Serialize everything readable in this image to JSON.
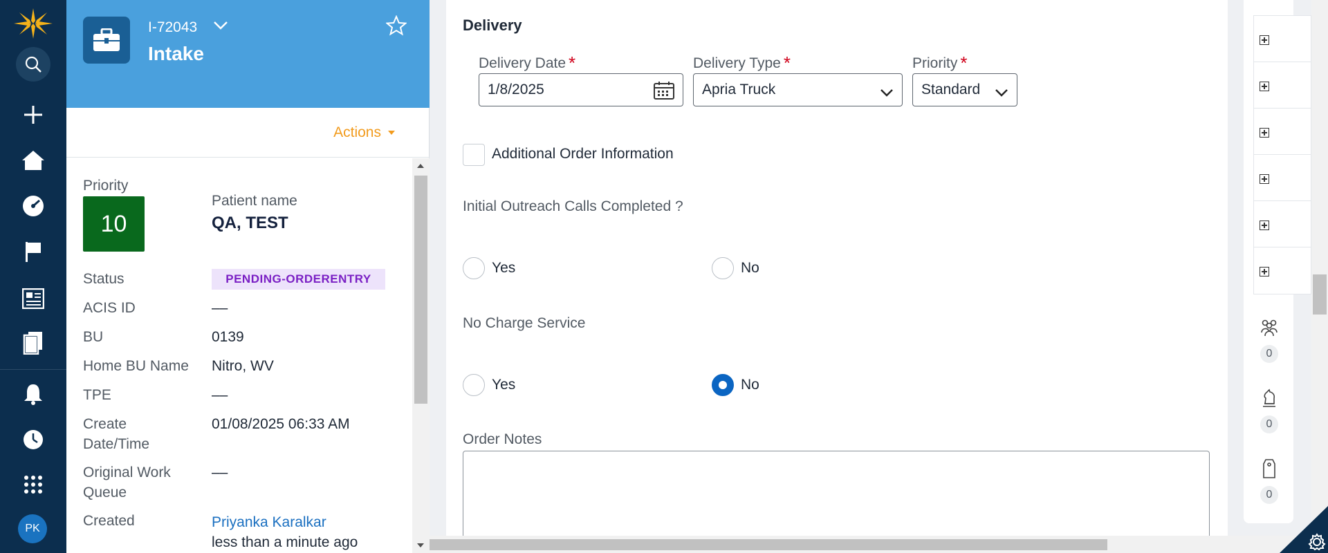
{
  "nav": {
    "avatar_initials": "PK",
    "icons": [
      "logo-icon",
      "search-icon",
      "plus-icon",
      "home-icon",
      "dashboard-icon",
      "flag-icon",
      "news-icon",
      "documents-icon",
      "bell-icon",
      "history-icon",
      "apps-grid-icon"
    ]
  },
  "case": {
    "id": "I-72043",
    "title": "Intake",
    "actions_label": "Actions",
    "priority_label": "Priority",
    "priority_value": "10",
    "patient_name_label": "Patient name",
    "patient_name": "QA, TEST",
    "fields": [
      {
        "label": "Status",
        "value": "PENDING-ORDERENTRY"
      },
      {
        "label": "ACIS ID",
        "value": "––"
      },
      {
        "label": "BU",
        "value": "0139"
      },
      {
        "label": "Home BU Name",
        "value": "Nitro, WV"
      },
      {
        "label": "TPE",
        "value": "––"
      },
      {
        "label": "Create Date/Time",
        "value": "01/08/2025 06:33 AM"
      },
      {
        "label": "Original Work Queue",
        "value": "––"
      },
      {
        "label": "Created",
        "value": "Priyanka Karalkar",
        "sub": "less than a minute ago"
      }
    ],
    "colors": {
      "header": "#4aa0dd",
      "priority_box": "#09691d",
      "status_badge_bg": "#ede3fb",
      "status_badge_text": "#7a1fc4",
      "actions": "#f29b1d"
    }
  },
  "form": {
    "section_title": "Delivery",
    "delivery_date_label": "Delivery Date",
    "delivery_date_value": "1/8/2025",
    "delivery_type_label": "Delivery Type",
    "delivery_type_value": "Apria Truck",
    "priority_label": "Priority",
    "priority_value": "Standard",
    "required_mark": "*",
    "additional_info_label": "Additional Order Information",
    "additional_info_checked": false,
    "outreach_question": "Initial Outreach Calls Completed ?",
    "outreach_options": [
      "Yes",
      "No"
    ],
    "outreach_selected": null,
    "no_charge_question": "No Charge Service",
    "no_charge_options": [
      "Yes",
      "No"
    ],
    "no_charge_selected": "No",
    "order_notes_label": "Order Notes",
    "order_notes_value": ""
  },
  "rail": {
    "expanders": 6,
    "counts": [
      {
        "icon": "people-icon",
        "count": "0"
      },
      {
        "icon": "chess-knight-icon",
        "count": "0"
      },
      {
        "icon": "tag-icon",
        "count": "0"
      }
    ]
  }
}
